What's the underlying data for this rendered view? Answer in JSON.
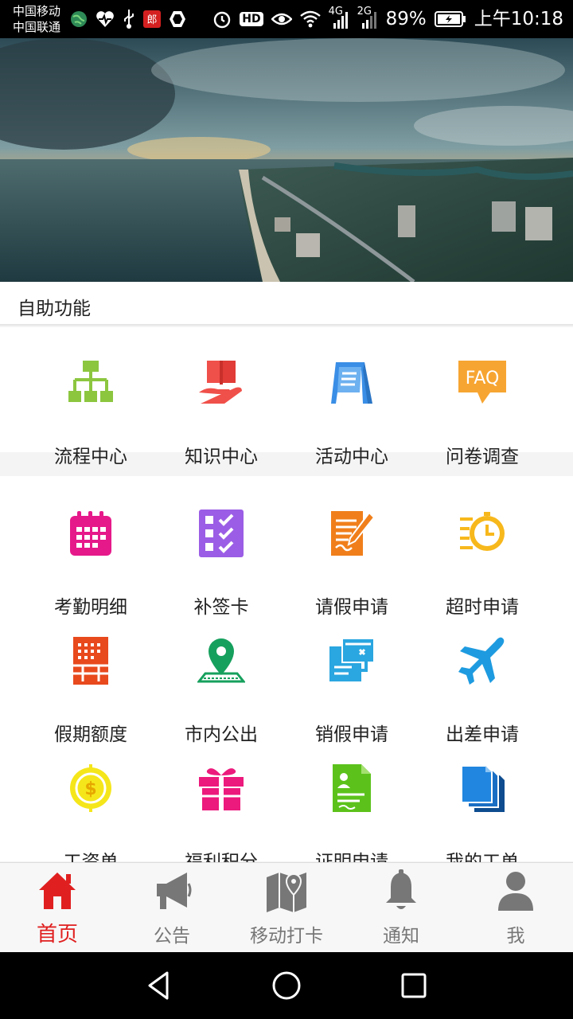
{
  "status_bar": {
    "carrier_1": "中国移动",
    "carrier_2": "中国联通",
    "signal_4g": "4G",
    "signal_2g": "2G",
    "hd_badge": "HD",
    "battery": "89%",
    "time": "上午10:18",
    "icons_left": [
      "globe-icon",
      "health-icon",
      "usb-icon",
      "mail-app-icon",
      "shield-app-icon"
    ],
    "icons_right": [
      "alarm-icon",
      "hd-icon",
      "eye-icon",
      "wifi-icon",
      "signal-4g-icon",
      "signal-2g-icon",
      "battery-icon"
    ]
  },
  "section": {
    "title": "自助功能"
  },
  "top_functions": [
    {
      "label": "流程中心",
      "icon": "flowchart-icon",
      "color": "#8cc63f"
    },
    {
      "label": "知识中心",
      "icon": "book-hand-icon",
      "color": "#f0504a"
    },
    {
      "label": "活动中心",
      "icon": "easel-board-icon",
      "color": "#3a8ee6"
    },
    {
      "label": "问卷调查",
      "icon": "faq-icon",
      "color": "#f7a532"
    }
  ],
  "main_functions": [
    {
      "label": "考勤明细",
      "icon": "calendar-icon",
      "color": "#e6198a"
    },
    {
      "label": "补签卡",
      "icon": "checklist-icon",
      "color": "#9b5de5"
    },
    {
      "label": "请假申请",
      "icon": "form-edit-icon",
      "color": "#f07f1b"
    },
    {
      "label": "超时申请",
      "icon": "clock-overtime-icon",
      "color": "#f7b81c"
    },
    {
      "label": "假期额度",
      "icon": "vacation-quota-icon",
      "color": "#e8491d"
    },
    {
      "label": "市内公出",
      "icon": "map-pin-icon",
      "color": "#16a05d"
    },
    {
      "label": "销假申请",
      "icon": "cancel-leave-icon",
      "color": "#2aa6e0"
    },
    {
      "label": "出差申请",
      "icon": "airplane-icon",
      "color": "#1e9be0"
    },
    {
      "label": "工资单",
      "icon": "coin-icon",
      "color": "#f5e61b"
    },
    {
      "label": "福利积分",
      "icon": "gift-icon",
      "color": "#ec1a7c"
    },
    {
      "label": "证明申请",
      "icon": "certificate-icon",
      "color": "#5cc21b"
    },
    {
      "label": "我的工单",
      "icon": "documents-icon",
      "color": "#1a6fc4"
    }
  ],
  "bottom_nav": [
    {
      "label": "首页",
      "icon": "home-icon",
      "active": true
    },
    {
      "label": "公告",
      "icon": "megaphone-icon",
      "active": false
    },
    {
      "label": "移动打卡",
      "icon": "map-checkin-icon",
      "active": false
    },
    {
      "label": "通知",
      "icon": "bell-icon",
      "active": false
    },
    {
      "label": "我",
      "icon": "person-icon",
      "active": false
    }
  ],
  "colors": {
    "active": "#e02020",
    "inactive": "#777777"
  }
}
